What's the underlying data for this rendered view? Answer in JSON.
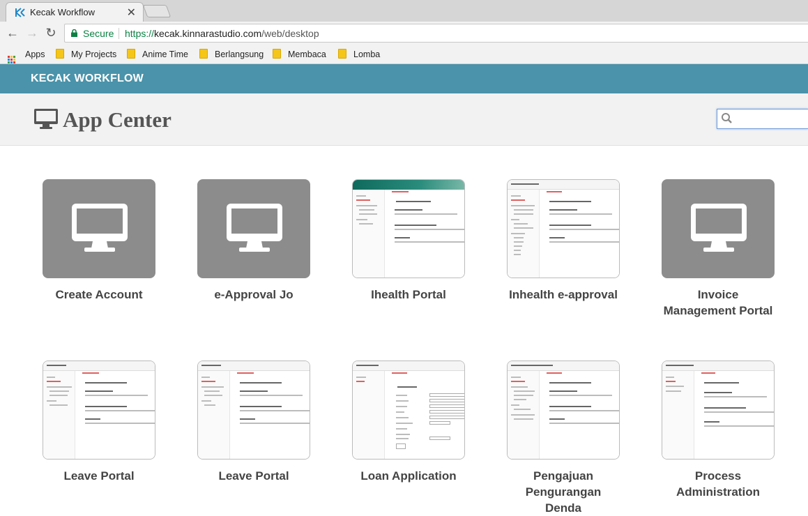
{
  "browser": {
    "tab_title": "Kecak Workflow",
    "secure_label": "Secure",
    "url_scheme": "https://",
    "url_host": "kecak.kinnarastudio.com",
    "url_path": "/web/desktop",
    "bookmarks": [
      "Apps",
      "My Projects",
      "Anime Time",
      "Berlangsung",
      "Membaca",
      "Lomba"
    ]
  },
  "app": {
    "brand": "KECAK WORKFLOW",
    "page_title": "App Center",
    "search_placeholder": ""
  },
  "apps": [
    {
      "label": "Create Account",
      "thumb": "monitor-icon"
    },
    {
      "label": "e-Approval Jo",
      "thumb": "monitor-icon"
    },
    {
      "label": "Ihealth Portal",
      "thumb": "screenshot"
    },
    {
      "label": "Inhealth e-approval",
      "thumb": "screenshot"
    },
    {
      "label": "Invoice Management Portal",
      "thumb": "monitor-icon"
    },
    {
      "label": "Leave Portal",
      "thumb": "screenshot"
    },
    {
      "label": "Leave Portal",
      "thumb": "screenshot"
    },
    {
      "label": "Loan Application",
      "thumb": "screenshot"
    },
    {
      "label": "Pengajuan Pengurangan Denda",
      "thumb": "screenshot"
    },
    {
      "label": "Process Administration",
      "thumb": "screenshot"
    }
  ],
  "colors": {
    "header": "#4a93aa",
    "tile_gray": "#8c8c8c",
    "secure_green": "#0b8043"
  }
}
